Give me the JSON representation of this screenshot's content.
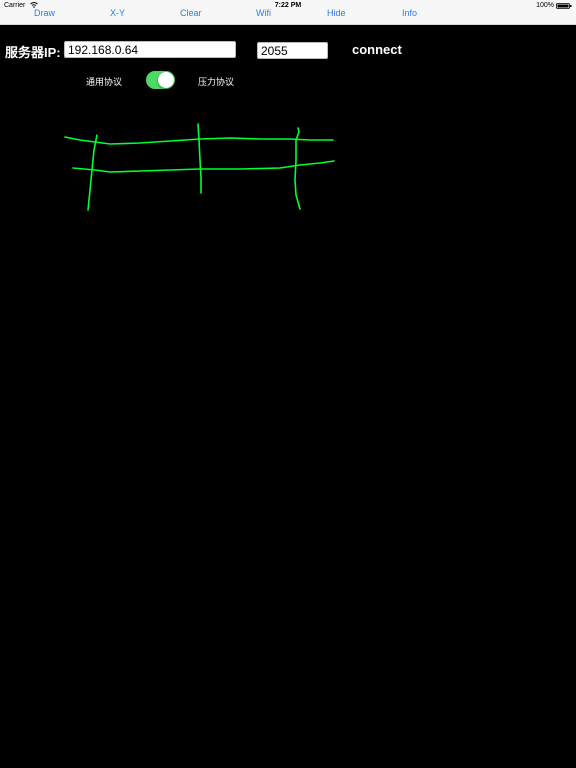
{
  "status": {
    "carrier": "Carrier",
    "time": "7:22 PM",
    "battery": "100%"
  },
  "toolbar": {
    "items": [
      "Draw",
      "X-Y",
      "Clear",
      "Wifi",
      "Hide",
      "Info"
    ]
  },
  "connection": {
    "ip_label": "服务器IP:",
    "ip_value": "192.168.0.64",
    "port_value": "2055",
    "connect_label": "connect"
  },
  "protocol": {
    "left_label": "通用协议",
    "right_label": "压力协议",
    "toggle_on": true
  },
  "colors": {
    "accent": "#2a7de1",
    "toggle": "#4cd964",
    "stroke": "#00ff33"
  }
}
